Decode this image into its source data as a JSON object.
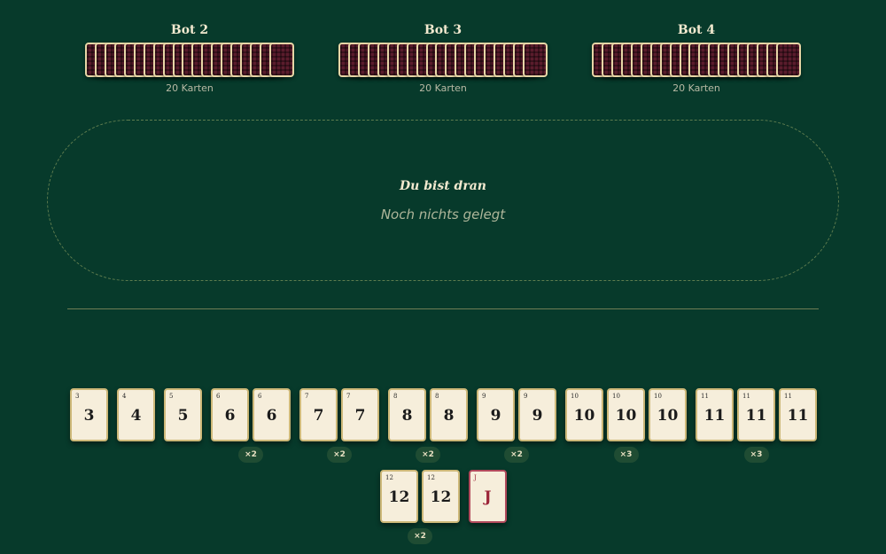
{
  "bots": [
    {
      "name": "Bot 2",
      "count_label": "20 Karten",
      "cards": 20
    },
    {
      "name": "Bot 3",
      "count_label": "20 Karten",
      "cards": 20
    },
    {
      "name": "Bot 4",
      "count_label": "20 Karten",
      "cards": 20
    }
  ],
  "table": {
    "turn_label": "Du bist dran",
    "empty_label": "Noch nichts gelegt"
  },
  "hand": {
    "rows": [
      [
        {
          "rank": "3",
          "count": 1
        },
        {
          "rank": "4",
          "count": 1
        },
        {
          "rank": "5",
          "count": 1
        },
        {
          "rank": "6",
          "count": 2,
          "badge": "×2"
        },
        {
          "rank": "7",
          "count": 2,
          "badge": "×2"
        },
        {
          "rank": "8",
          "count": 2,
          "badge": "×2"
        },
        {
          "rank": "9",
          "count": 2,
          "badge": "×2"
        },
        {
          "rank": "10",
          "count": 3,
          "badge": "×3"
        },
        {
          "rank": "11",
          "count": 3,
          "badge": "×3"
        }
      ],
      [
        {
          "rank": "12",
          "count": 2,
          "badge": "×2"
        },
        {
          "rank": "J",
          "count": 1,
          "joker": true
        }
      ]
    ]
  },
  "colors": {
    "felt": "#073a2b",
    "card_face": "#f6eedb",
    "card_back": "#5a1c2c",
    "joker": "#9c2438"
  }
}
